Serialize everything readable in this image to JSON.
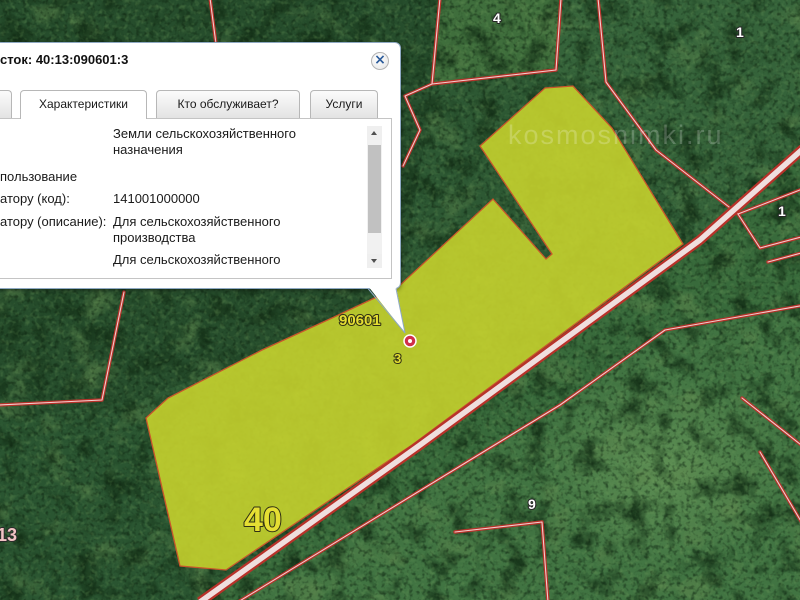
{
  "map": {
    "watermark": "kosmosnimki.ru",
    "labels": {
      "top_4": "4",
      "top_right_1": "1",
      "right_1": "1",
      "bottom_9": "9",
      "big_40": "40",
      "left_13": "13",
      "quarter": "90601",
      "parcel": "3"
    },
    "colors": {
      "parcel_fill": "#c5d22e",
      "parcel_outline": "#c9562b",
      "boundary": "#b8322a",
      "label_yellow": "#e6df33",
      "marker": "#d0304a"
    },
    "icons": {
      "marker": "marker-icon"
    }
  },
  "popup": {
    "title": "сток: 40:13:090601:3",
    "tabs": [
      {
        "label": "Характеристики",
        "active": true
      },
      {
        "label": "Кто обслуживает?",
        "active": false
      },
      {
        "label": "Услуги",
        "active": false
      }
    ],
    "rows": [
      {
        "value": "Земли сельскохозяйственного назначения"
      },
      {
        "label": "пользование"
      },
      {
        "label": "атору (код):",
        "value": "141001000000"
      },
      {
        "label": "атору (описание):",
        "value": "Для сельскохозяйственного производства"
      },
      {
        "value": "Для сельскохозяйственного"
      }
    ],
    "icons": {
      "close": "close-icon",
      "scroll_up": "scroll-up-icon",
      "scroll_down": "scroll-down-icon"
    }
  }
}
